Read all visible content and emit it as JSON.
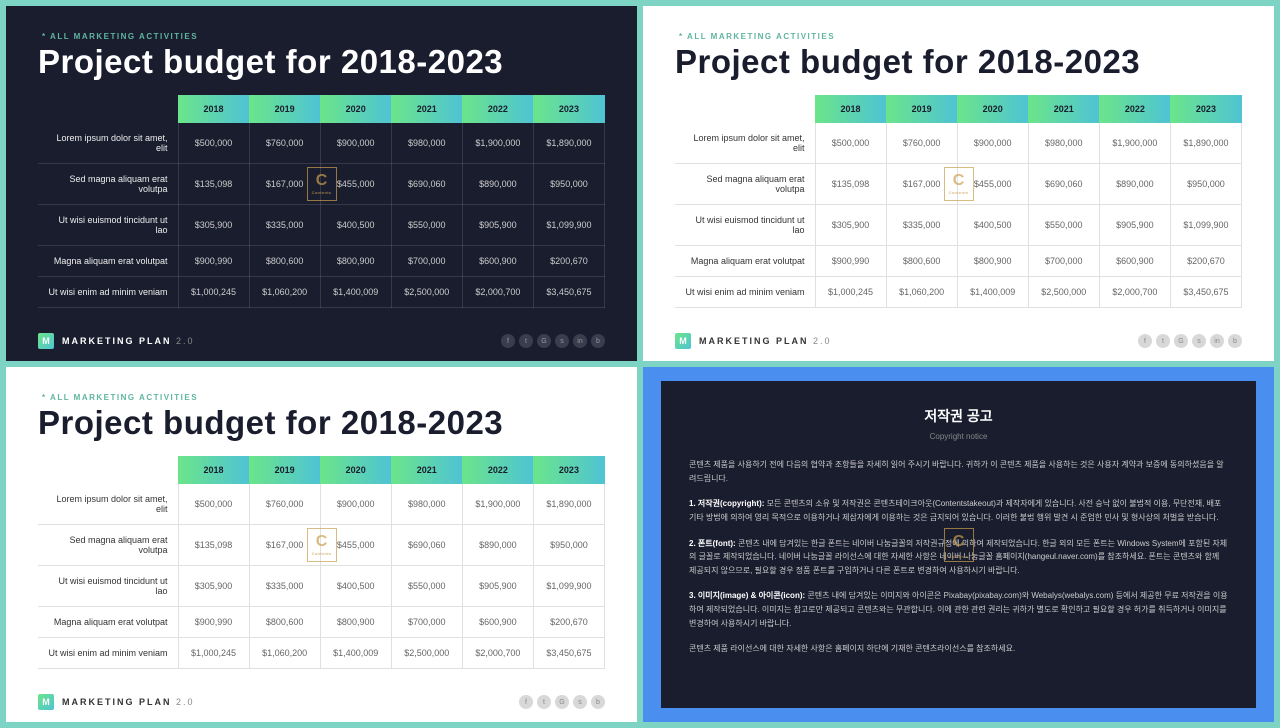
{
  "eyebrow": "* ALL MARKETING ACTIVITIES",
  "title": "Project budget for 2018-2023",
  "years": [
    "2018",
    "2019",
    "2020",
    "2021",
    "2022",
    "2023"
  ],
  "rows": [
    {
      "label": "Lorem ipsum dolor sit amet, elit",
      "v": [
        "$500,000",
        "$760,000",
        "$900,000",
        "$980,000",
        "$1,900,000",
        "$1,890,000"
      ]
    },
    {
      "label": "Sed magna aliquam erat volutpa",
      "v": [
        "$135,098",
        "$167,000",
        "$455,000",
        "$690,060",
        "$890,000",
        "$950,000"
      ]
    },
    {
      "label": "Ut wisi euismod tincidunt ut lao",
      "v": [
        "$305,900",
        "$335,000",
        "$400,500",
        "$550,000",
        "$905,900",
        "$1,099,900"
      ]
    },
    {
      "label": "Magna aliquam erat volutpat",
      "v": [
        "$900,990",
        "$800,600",
        "$800,900",
        "$700,000",
        "$600,900",
        "$200,670"
      ]
    },
    {
      "label": "Ut wisi enim ad minim veniam",
      "v": [
        "$1,000,245",
        "$1,060,200",
        "$1,400,009",
        "$2,500,000",
        "$2,000,700",
        "$3,450,675"
      ]
    }
  ],
  "footer": {
    "badge": "M",
    "name": "MARKETING PLAN",
    "ver": "2.0"
  },
  "social": [
    "f",
    "t",
    "G",
    "s",
    "in",
    "b"
  ],
  "social_light": [
    "f",
    "t",
    "G",
    "s",
    "b"
  ],
  "copyright": {
    "title": "저작권 공고",
    "sub": "Copyright notice",
    "intro": "콘텐츠 제품을 사용하기 전에 다음의 협약과 조항들을 자세히 읽어 주시기 바랍니다. 귀하가 이 콘텐츠 제품을 사용하는 것은 사용자 계약과 보증에 동의하셨음을 알려드립니다.",
    "p1_h": "1. 저작권(copyright):",
    "p1": " 모든 콘텐츠의 소유 및 저작권은 콘텐츠테이크아웃(Contentstakeout)과 제작자에게 있습니다. 사전 승낙 없이 불법적 이용, 무단전재, 배포 기타 방법에 의하여 영리 목적으로 이용하거나 제삼자에게 이용하는 것은 금지되어 있습니다. 이러한 불법 행위 발견 시 준엄한 민사 및 형사상의 처벌을 받습니다.",
    "p2_h": "2. 폰트(font):",
    "p2": " 콘텐츠 내에 담겨있는 한글 폰트는 네이버 나눔글꼴의 저작권규정에 의하여 제작되었습니다. 한글 외의 모든 폰트는 Windows System에 포함된 자체의 글꼴로 제작되었습니다. 네이버 나눔글꼴 라이선스에 대한 자세한 사항은 네이버 나눔글꼴 홈페이지(hangeul.naver.com)를 참조하세요. 폰트는 콘텐츠와 함께 제공되지 않으므로, 필요할 경우 정품 폰트를 구입하거나 다른 폰트로 변경하여 사용하시기 바랍니다.",
    "p3_h": "3. 이미지(image) & 아이콘(icon):",
    "p3": " 콘텐츠 내에 담겨있는 이미지와 아이콘은 Pixabay(pixabay.com)와 Webalys(webalys.com) 등에서 제공한 무료 저작권을 이용하여 제작되었습니다. 이미지는 참고로만 제공되고 콘텐츠와는 무관합니다. 이에 관한 관련 권리는 귀하가 별도로 확인하고 필요할 경우 허가를 취득하거나 이미지를 변경하여 사용하시기 바랍니다.",
    "outro": "콘텐츠 제품 라이선스에 대한 자세한 사항은 홈페이지 하단에 기재한 콘텐츠라이선스를 참조하세요."
  },
  "chart_data": {
    "type": "table",
    "title": "Project budget for 2018-2023",
    "categories": [
      "2018",
      "2019",
      "2020",
      "2021",
      "2022",
      "2023"
    ],
    "series": [
      {
        "name": "Lorem ipsum dolor sit amet, elit",
        "values": [
          500000,
          760000,
          900000,
          980000,
          1900000,
          1890000
        ]
      },
      {
        "name": "Sed magna aliquam erat volutpa",
        "values": [
          135098,
          167000,
          455000,
          690060,
          890000,
          950000
        ]
      },
      {
        "name": "Ut wisi euismod tincidunt ut lao",
        "values": [
          305900,
          335000,
          400500,
          550000,
          905900,
          1099900
        ]
      },
      {
        "name": "Magna aliquam erat volutpat",
        "values": [
          900990,
          800600,
          800900,
          700000,
          600900,
          200670
        ]
      },
      {
        "name": "Ut wisi enim ad minim veniam",
        "values": [
          1000245,
          1060200,
          1400009,
          2500000,
          2000700,
          3450675
        ]
      }
    ]
  }
}
